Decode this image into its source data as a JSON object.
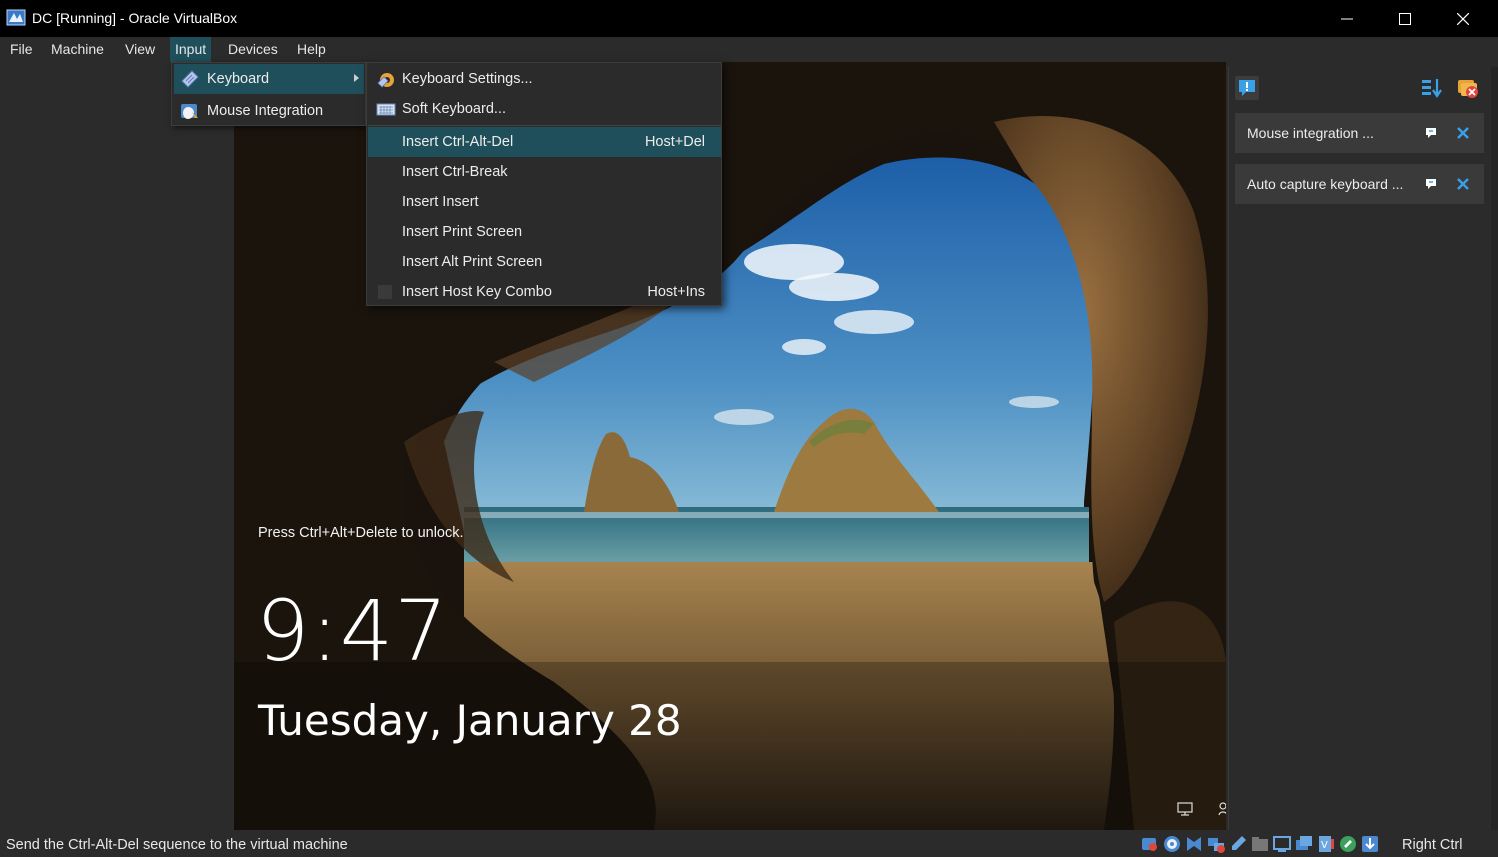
{
  "window": {
    "title": "DC [Running] - Oracle VirtualBox"
  },
  "menubar": {
    "items": [
      {
        "label": "File"
      },
      {
        "label": "Machine"
      },
      {
        "label": "View"
      },
      {
        "label": "Input"
      },
      {
        "label": "Devices"
      },
      {
        "label": "Help"
      }
    ],
    "active": "Input"
  },
  "input_menu": {
    "items": [
      {
        "label": "Keyboard",
        "icon": "keyboard-icon",
        "has_submenu": true,
        "highlighted": true
      },
      {
        "label": "Mouse Integration",
        "icon": "mouse-integration-icon",
        "has_submenu": false,
        "highlighted": false
      }
    ]
  },
  "keyboard_submenu": {
    "items": [
      {
        "label": "Keyboard Settings...",
        "shortcut": "",
        "icon": "keyboard-settings-icon"
      },
      {
        "label": "Soft Keyboard...",
        "shortcut": "",
        "icon": "soft-keyboard-icon"
      },
      {
        "label": "Insert Ctrl-Alt-Del",
        "shortcut": "Host+Del",
        "highlighted": true
      },
      {
        "label": "Insert Ctrl-Break",
        "shortcut": ""
      },
      {
        "label": "Insert Insert",
        "shortcut": ""
      },
      {
        "label": "Insert Print Screen",
        "shortcut": ""
      },
      {
        "label": "Insert Alt Print Screen",
        "shortcut": ""
      },
      {
        "label": "Insert Host Key Combo",
        "shortcut": "Host+Ins"
      }
    ]
  },
  "vm_screen": {
    "hint": "Press Ctrl+Alt+Delete to unlock.",
    "time": "9:47",
    "date": "Tuesday, January 28"
  },
  "notification_panel": {
    "header_icons": [
      "notification-center-icon",
      "sort-icon",
      "clear-all-icon"
    ],
    "cards": [
      {
        "label": "Mouse integration ..."
      },
      {
        "label": "Auto capture keyboard ..."
      }
    ]
  },
  "statusbar": {
    "message": "Send the Ctrl-Alt-Del sequence to the virtual machine",
    "host_key": "Right Ctrl",
    "icons": [
      "hard-disk-icon",
      "optical-drive-icon",
      "audio-icon",
      "network-icon",
      "usb-icon",
      "shared-folders-icon",
      "display-icon",
      "recording-icon",
      "cpu-icon",
      "mouse-icon",
      "keyboard-capture-icon"
    ]
  },
  "colors": {
    "menu_bg": "#2b2b2b",
    "highlight": "#1f4f5b",
    "title_bg": "#000000",
    "accent_blue": "#3aa0e8"
  }
}
